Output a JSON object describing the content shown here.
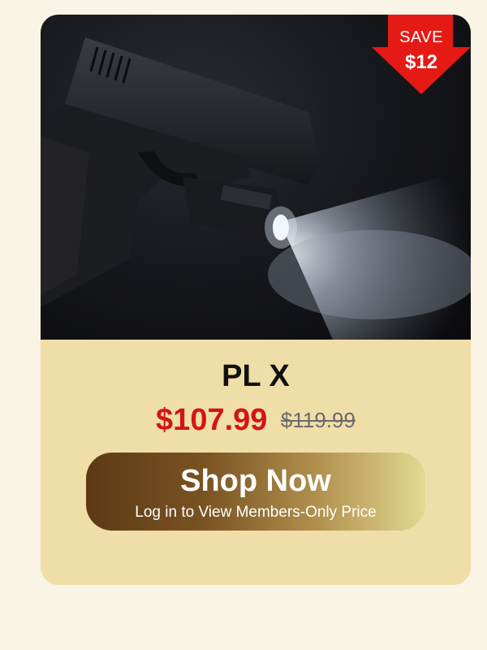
{
  "badge": {
    "save_label": "SAVE",
    "save_amount": "$12",
    "color": "#e51a14"
  },
  "product": {
    "name": "PL X",
    "price_current": "$107.99",
    "price_original": "$119.99"
  },
  "cta": {
    "title": "Shop Now",
    "subtitle": "Log in to View Members-Only Price"
  },
  "colors": {
    "background": "#f9f4e3",
    "card": "#f0dea8",
    "price": "#d41414"
  },
  "hero": {
    "image": "pistol-with-weapon-light-photo"
  }
}
